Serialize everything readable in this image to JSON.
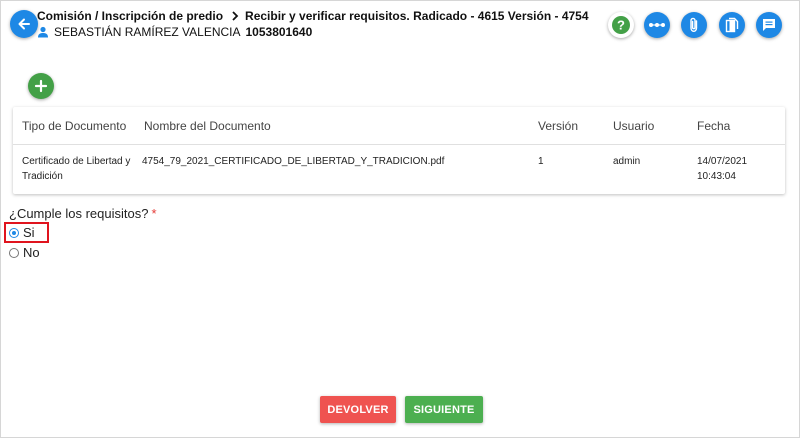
{
  "header": {
    "breadcrumb_path": "Comisión / Inscripción de predio",
    "breadcrumb_current": "Recibir y verificar requisitos. Radicado - 4615 Versión - 4754",
    "user_name": "SEBASTIÁN RAMÍREZ VALENCIA",
    "user_id": "1053801640"
  },
  "toolbar": {
    "icons": [
      "help-icon",
      "more-horizontal-icon",
      "attachment-icon",
      "document-icon",
      "comment-icon"
    ]
  },
  "table": {
    "headers": [
      "Tipo de Documento",
      "Nombre del Documento",
      "Versión",
      "Usuario",
      "Fecha"
    ],
    "rows": [
      {
        "tipo_line1": "Certificado de Libertad y",
        "tipo_line2": "Tradición",
        "nombre": "4754_79_2021_CERTIFICADO_DE_LIBERTAD_Y_TRADICION.pdf",
        "version": "1",
        "usuario": "admin",
        "fecha_line1": "14/07/2021",
        "fecha_line2": "10:43:04"
      }
    ]
  },
  "question": {
    "label": "¿Cumple los requisitos?",
    "required_mark": "*",
    "options": [
      "Si",
      "No"
    ],
    "selected": "Si"
  },
  "actions": {
    "return_label": "DEVOLVER",
    "next_label": "SIGUIENTE"
  },
  "colors": {
    "primary": "#1e88e5",
    "success": "#4caf50",
    "danger": "#ef5350",
    "highlight": "#e0141e"
  }
}
